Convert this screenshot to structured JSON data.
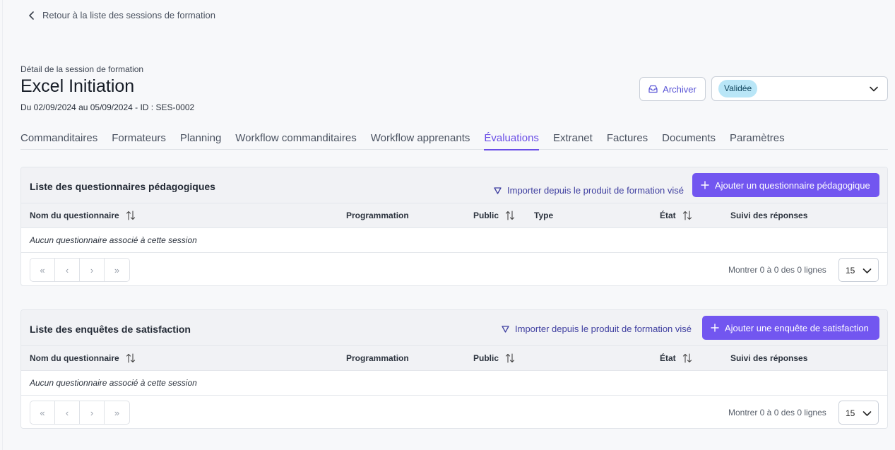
{
  "back_link": "Retour à la liste des sessions de formation",
  "header": {
    "subtitle": "Détail de la session de formation",
    "title": "Excel Initiation",
    "dates": "Du 02/09/2024 au 05/09/2024 - ID : SES-0002",
    "archive_label": "Archiver",
    "status_value": "Validée"
  },
  "tabs": [
    {
      "label": "Commanditaires"
    },
    {
      "label": "Formateurs"
    },
    {
      "label": "Planning"
    },
    {
      "label": "Workflow commanditaires"
    },
    {
      "label": "Workflow apprenants"
    },
    {
      "label": "Évaluations",
      "active": true
    },
    {
      "label": "Extranet"
    },
    {
      "label": "Factures"
    },
    {
      "label": "Documents"
    },
    {
      "label": "Paramètres"
    }
  ],
  "pedagogical": {
    "title": "Liste des questionnaires pédagogiques",
    "import_label": "Importer depuis le produit de formation visé",
    "add_label": "Ajouter un questionnaire pédagogique",
    "columns": {
      "name": "Nom du questionnaire",
      "programming": "Programmation",
      "public": "Public",
      "type": "Type",
      "state": "État",
      "tracking": "Suivi des réponses"
    },
    "empty_text": "Aucun questionnaire associé à cette session",
    "row_count": "Montrer 0 à 0 des 0 lignes",
    "page_size": "15"
  },
  "satisfaction": {
    "title": "Liste des enquêtes de satisfaction",
    "import_label": "Importer depuis le produit de formation visé",
    "add_label": "Ajouter une enquête de satisfaction",
    "columns": {
      "name": "Nom du questionnaire",
      "programming": "Programmation",
      "public": "Public",
      "state": "État",
      "tracking": "Suivi des réponses"
    },
    "empty_text": "Aucun questionnaire associé à cette session",
    "row_count": "Montrer 0 à 0 des 0 lignes",
    "page_size": "15"
  },
  "pagination_glyphs": [
    "«",
    "‹",
    "›",
    "»"
  ],
  "colors": {
    "accent": "#7256f0",
    "active_tab": "#6a4ee6",
    "status_badge_bg": "#b9e6f7"
  }
}
